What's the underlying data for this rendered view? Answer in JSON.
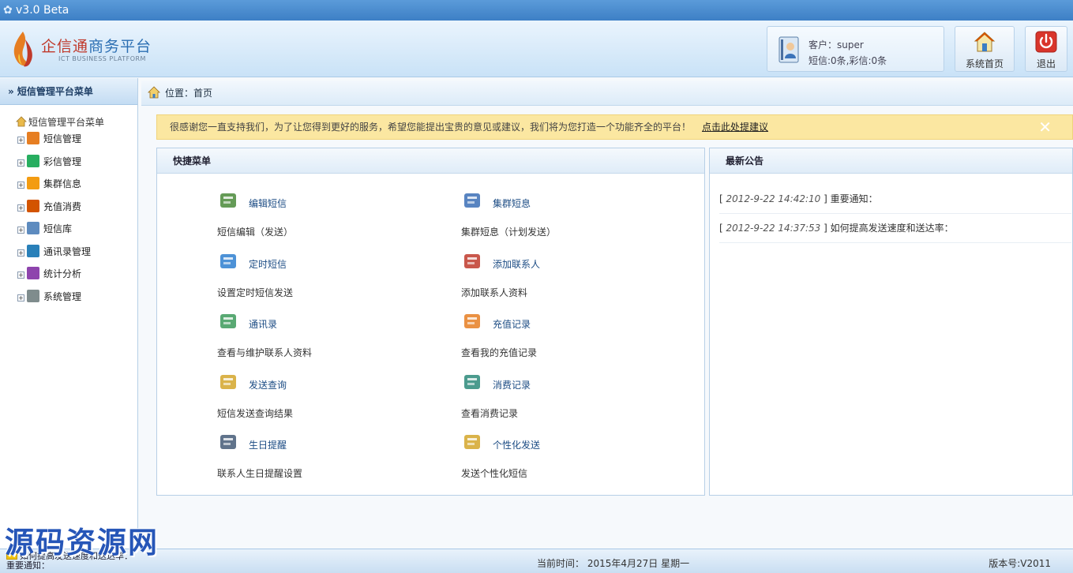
{
  "titlebar": {
    "title": "v3.0  Beta"
  },
  "header": {
    "logo": {
      "name_part1": "企信通",
      "name_part2": "商务平台",
      "subtitle": "ICT BUSINESS PLATFORM"
    },
    "user": {
      "customer": "客户：super",
      "quota": "短信:0条,彩信:0条"
    },
    "home_button": "系统首页",
    "exit_button": "退出"
  },
  "sidebar": {
    "title": "» 短信管理平台菜单",
    "root": "短信管理平台菜单",
    "items": [
      {
        "label": "短信管理",
        "icon": "sms-icon",
        "color": "#e67e22"
      },
      {
        "label": "彩信管理",
        "icon": "mms-icon",
        "color": "#27ae60"
      },
      {
        "label": "集群信息",
        "icon": "cluster-icon",
        "color": "#f39c12"
      },
      {
        "label": "充值消费",
        "icon": "recharge-icon",
        "color": "#d35400"
      },
      {
        "label": "短信库",
        "icon": "library-icon",
        "color": "#5d8bbf"
      },
      {
        "label": "通讯录管理",
        "icon": "contacts-icon",
        "color": "#2980b9"
      },
      {
        "label": "统计分析",
        "icon": "chart-icon",
        "color": "#8e44ad"
      },
      {
        "label": "系统管理",
        "icon": "settings-icon",
        "color": "#7f8c8d"
      }
    ]
  },
  "location": {
    "text": "位置：首页"
  },
  "notice": {
    "text": "很感谢您一直支持我们，为了让您得到更好的服务，希望您能提出宝贵的意见或建议，我们将为您打造一个功能齐全的平台！",
    "link": "点击此处提建议",
    "close": "✕"
  },
  "quick_menu": {
    "title": "快捷菜单",
    "items": [
      {
        "title": "编辑短信",
        "desc": "短信编辑（发送）",
        "icon": "edit-sms-icon",
        "color": "#4a8a3a"
      },
      {
        "title": "集群短息",
        "desc": "集群短息（计划发送）",
        "icon": "cluster-sms-icon",
        "color": "#3b6fb6"
      },
      {
        "title": "定时短信",
        "desc": "设置定时短信发送",
        "icon": "alarm-clock-icon",
        "color": "#2e7fd0"
      },
      {
        "title": "添加联系人",
        "desc": "添加联系人资料",
        "icon": "add-contact-icon",
        "color": "#c0392b"
      },
      {
        "title": "通讯录",
        "desc": "查看与维护联系人资料",
        "icon": "address-book-icon",
        "color": "#3c9a5a"
      },
      {
        "title": "充值记录",
        "desc": "查看我的充值记录",
        "icon": "cart-icon",
        "color": "#e67e22"
      },
      {
        "title": "发送查询",
        "desc": "短信发送查询结果",
        "icon": "send-query-icon",
        "color": "#d4a62a"
      },
      {
        "title": "消费记录",
        "desc": "查看消费记录",
        "icon": "download-icon",
        "color": "#2b8a7a"
      },
      {
        "title": "生日提醒",
        "desc": "联系人生日提醒设置",
        "icon": "birthday-icon",
        "color": "#445a77"
      },
      {
        "title": "个性化发送",
        "desc": "发送个性化短信",
        "icon": "personal-send-icon",
        "color": "#d4a62a"
      }
    ]
  },
  "news": {
    "title": "最新公告",
    "items": [
      {
        "time": "2012-9-22 14:42:10",
        "title": "重要通知："
      },
      {
        "time": "2012-9-22 14:37:53",
        "title": "如何提高发送速度和送达率："
      }
    ]
  },
  "footer": {
    "ticker_line1": "如何提高发送速度和送达率：",
    "ticker_line2": "重要通知：",
    "time": "当前时间：  2015年4月27日 星期一",
    "version": "版本号:V2011"
  },
  "watermark": "源码资源网"
}
